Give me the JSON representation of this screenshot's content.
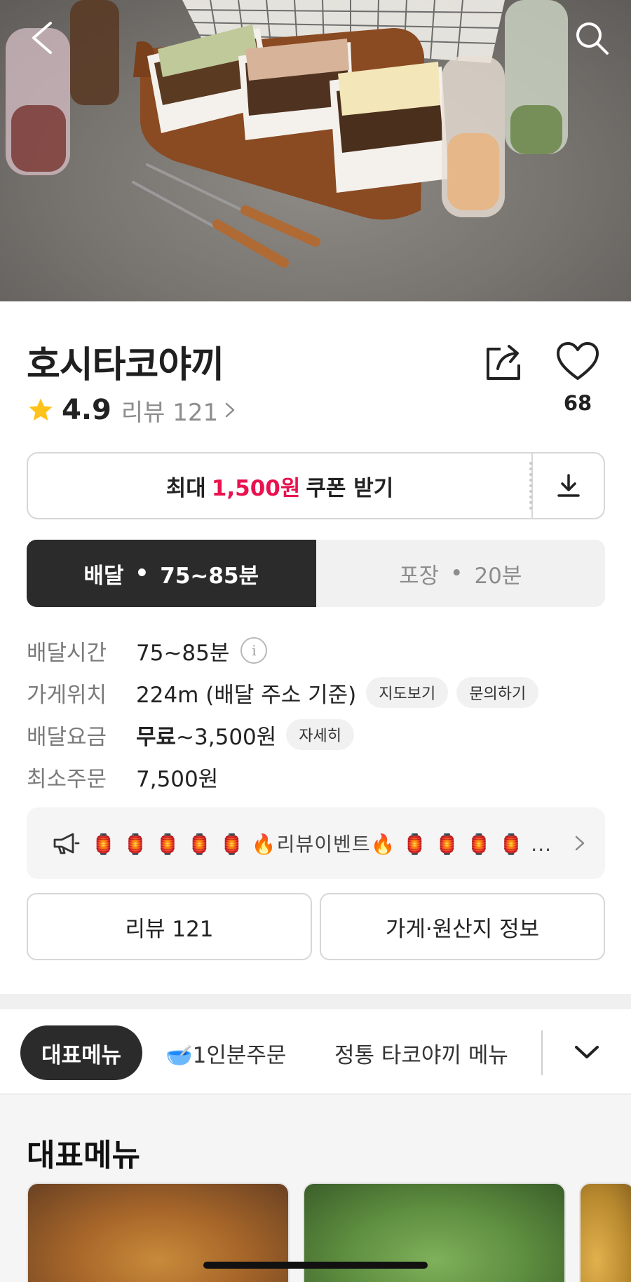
{
  "hero": {
    "image_desc_icon": "takoyaki-photo",
    "back_icon": "chevron-left-icon",
    "search_icon": "search-icon"
  },
  "store": {
    "name": "호시타코야끼",
    "rating": "4.9",
    "review_link": "리뷰 121",
    "favorite_count": "68"
  },
  "coupon": {
    "prefix": "최대",
    "amount": "1,500원",
    "suffix": "쿠폰 받기"
  },
  "mode_tabs": {
    "delivery_label": "배달",
    "delivery_time": "75~85분",
    "pickup_label": "포장",
    "pickup_time": "20분"
  },
  "info": {
    "delivery_time_label": "배달시간",
    "delivery_time_value": "75~85분",
    "location_label": "가게위치",
    "location_value": "224m (배달 주소 기준)",
    "map_chip": "지도보기",
    "inquiry_chip": "문의하기",
    "fee_label": "배달요금",
    "fee_free": "무료",
    "fee_rest": "~3,500원",
    "fee_detail_chip": "자세히",
    "min_order_label": "최소주문",
    "min_order_value": "7,500원"
  },
  "notice": {
    "text": "🏮 🏮 🏮 🏮 🏮 🔥리뷰이벤트🔥 🏮 🏮 🏮 🏮 ..."
  },
  "buttons": {
    "reviews": "리뷰 121",
    "store_info": "가게·원산지 정보"
  },
  "categories": {
    "active": "대표메뉴",
    "item1": "🥣1인분주문",
    "item2": "정통 타코야끼 메뉴"
  },
  "menu_section": {
    "title": "대표메뉴"
  },
  "colors": {
    "accent": "#e8124f",
    "dark": "#2b2b2b",
    "star": "#ffc21a"
  }
}
